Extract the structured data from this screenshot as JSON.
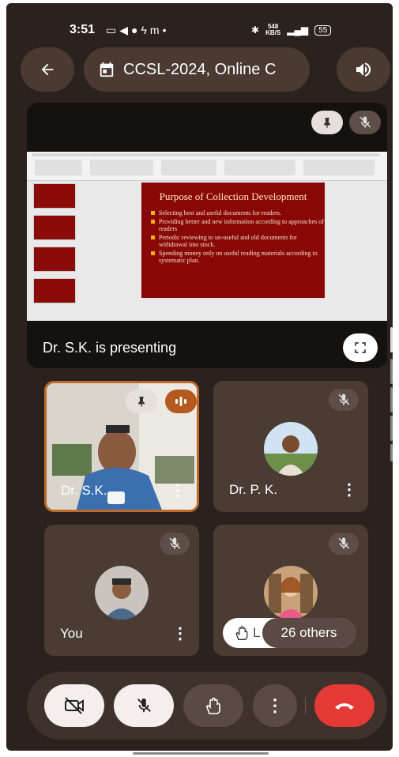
{
  "status_bar": {
    "time": "3:51",
    "carrier_letter": "m",
    "speed_value": "548",
    "speed_unit": "KB/S",
    "battery": "55"
  },
  "header": {
    "title": "CCSL-2024, Online C"
  },
  "presentation": {
    "presenter_label": "Dr. S.K. is presenting",
    "slide": {
      "title": "Purpose of Collection Development",
      "bullets": [
        "Selecting best and useful documents for readers.",
        "Providing better and new information according to approaches of readers",
        "Periodic reviewing to un-useful and old documents for withdrawal into stock.",
        "Spending money only on useful reading materials according to systematic plan."
      ]
    }
  },
  "participants": [
    {
      "name": "Dr. S.K."
    },
    {
      "name": "Dr. P. K."
    },
    {
      "name": "You"
    },
    {
      "name": "L"
    }
  ],
  "others": {
    "label": "26 others"
  },
  "colors": {
    "background": "#2b221d",
    "tile": "#4a3b33",
    "speaking_border": "#c06a2a",
    "end_call": "#e53935",
    "slide_bg": "#8a0707"
  },
  "icons": [
    "back-arrow-icon",
    "calendar-icon",
    "speaker-icon",
    "pin-icon",
    "mic-off-icon",
    "fullscreen-icon",
    "speaking-icon",
    "more-vert-icon",
    "hand-icon",
    "camera-off-icon",
    "end-call-icon"
  ]
}
